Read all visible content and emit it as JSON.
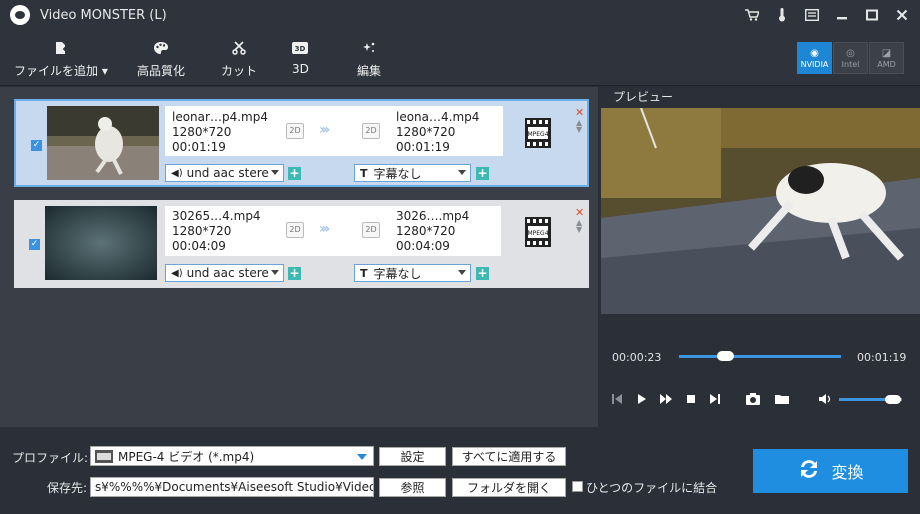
{
  "window": {
    "title": "Video MONSTER (L)"
  },
  "titlebar_icons": [
    "cart-icon",
    "thermometer-icon",
    "feedback-icon",
    "minimize-icon",
    "maximize-icon",
    "close-icon"
  ],
  "toolbar": {
    "add_file": "ファイルを追加",
    "enhance": "高品質化",
    "cut": "カット",
    "three_d": "3D",
    "edit": "編集",
    "gpu": {
      "nvidia": "NVIDIA",
      "intel": "Intel",
      "amd": "AMD"
    }
  },
  "files": [
    {
      "source_name": "leonar…p4.mp4",
      "source_res": "1280*720",
      "source_dur": "00:01:19",
      "output_name": "leona…4.mp4",
      "output_res": "1280*720",
      "output_dur": "00:01:19",
      "audio": "und aac stere",
      "subtitle": "字幕なし",
      "tag": "2D",
      "format": "MPEG4"
    },
    {
      "source_name": "30265…4.mp4",
      "source_res": "1280*720",
      "source_dur": "00:04:09",
      "output_name": "3026….mp4",
      "output_res": "1280*720",
      "output_dur": "00:04:09",
      "audio": "und aac stere",
      "subtitle": "字幕なし",
      "tag": "2D",
      "format": "MPEG4"
    }
  ],
  "preview": {
    "label": "プレビュー",
    "current_time": "00:00:23",
    "total_time": "00:01:19",
    "progress": 0.29,
    "volume": 0.85
  },
  "bottom": {
    "profile_label": "プロファイル:",
    "profile_value": "MPEG-4 ビデオ (*.mp4)",
    "settings_btn": "設定",
    "apply_all_btn": "すべてに適用する",
    "save_label": "保存先:",
    "save_path": "s¥%%%%¥Documents¥Aiseesoft Studio¥Video",
    "browse_btn": "参照",
    "open_folder_btn": "フォルダを開く",
    "merge_label": "ひとつのファイルに結合",
    "convert_btn": "変換"
  }
}
